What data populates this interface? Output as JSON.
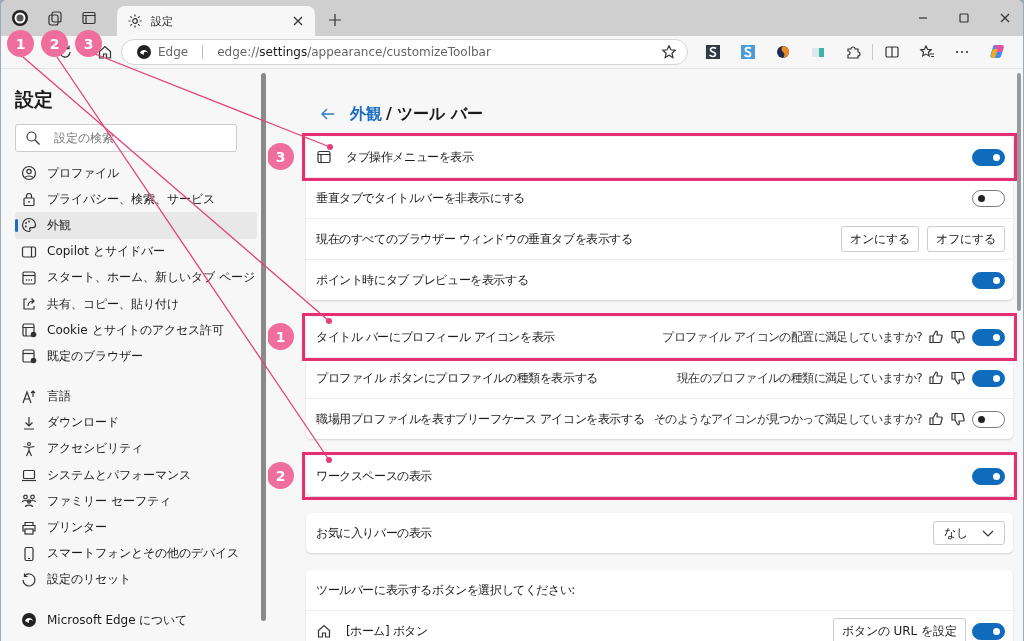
{
  "browser": {
    "tab": {
      "title": "設定",
      "selected": true
    },
    "address": {
      "site": "Edge",
      "url": "edge://**settings**/appearance/customizeToolbar"
    }
  },
  "top_callouts": [
    "1",
    "2",
    "3"
  ],
  "sidebar": {
    "title": "設定",
    "search": {
      "placeholder": "設定の検索"
    },
    "groups": [
      [
        {
          "label": "プロファイル",
          "selected": false
        },
        {
          "label": "プライバシー、検索、サービス",
          "selected": false
        },
        {
          "label": "外観",
          "selected": true
        },
        {
          "label": "Copilot とサイドバー",
          "selected": false
        },
        {
          "label": "スタート、ホーム、新しいタブ ページ",
          "selected": false
        },
        {
          "label": "共有、コピー、貼り付け",
          "selected": false
        },
        {
          "label": "Cookie とサイトのアクセス許可",
          "selected": false
        },
        {
          "label": "既定のブラウザー",
          "selected": false
        }
      ],
      [
        {
          "label": "言語",
          "selected": false
        },
        {
          "label": "ダウンロード",
          "selected": false
        },
        {
          "label": "アクセシビリティ",
          "selected": false
        },
        {
          "label": "システムとパフォーマンス",
          "selected": false
        },
        {
          "label": "ファミリー セーフティ",
          "selected": false
        },
        {
          "label": "プリンター",
          "selected": false
        },
        {
          "label": "スマートフォンとその他のデバイス",
          "selected": false
        },
        {
          "label": "設定のリセット",
          "selected": false
        }
      ],
      [
        {
          "label": "Microsoft Edge について",
          "selected": false
        }
      ]
    ]
  },
  "breadcrumb": {
    "parent": "外観",
    "current": "/ ツール バー"
  },
  "cards": [
    {
      "rows": [
        {
          "kind": "toggle",
          "label": "タブ操作メニューを表示",
          "on": true,
          "callout": "3"
        },
        {
          "kind": "toggle",
          "label": "垂直タブでタイトルバーを非表示にする",
          "on": false
        },
        {
          "kind": "buttons",
          "label": "現在のすべてのブラウザー ウィンドウの垂直タブを表示する",
          "buttons": [
            "オンにする",
            "オフにする"
          ]
        },
        {
          "kind": "toggle",
          "label": "ポイント時にタブ プレビューを表示する",
          "on": true
        }
      ]
    },
    {
      "rows": [
        {
          "kind": "feedback",
          "label": "タイトル バーにプロフィール アイコンを表示",
          "question": "プロファイル アイコンの配置に満足していますか?",
          "on": true,
          "callout": "1"
        },
        {
          "kind": "feedback",
          "label": "プロファイル ボタンにプロファイルの種類を表示する",
          "question": "現在のプロファイルの種類に満足していますか?",
          "on": true
        },
        {
          "kind": "feedback",
          "label": "職場用プロファイルを表すブリーフケース アイコンを表示する",
          "question": "そのようなアイコンが見つかって満足していますか?",
          "on": false
        }
      ]
    },
    {
      "rows": [
        {
          "kind": "toggle",
          "label": "ワークスペースの表示",
          "on": true,
          "callout": "2"
        }
      ]
    },
    {
      "rows": [
        {
          "kind": "dropdown",
          "label": "お気に入りバーの表示",
          "value": "なし"
        }
      ]
    },
    {
      "rows": [
        {
          "kind": "heading",
          "label": "ツールバーに表示するボタンを選択してください:"
        },
        {
          "kind": "button_toggle",
          "label": "[ホーム] ボタン",
          "button": "ボタンの URL を設定",
          "on": true
        }
      ]
    }
  ]
}
